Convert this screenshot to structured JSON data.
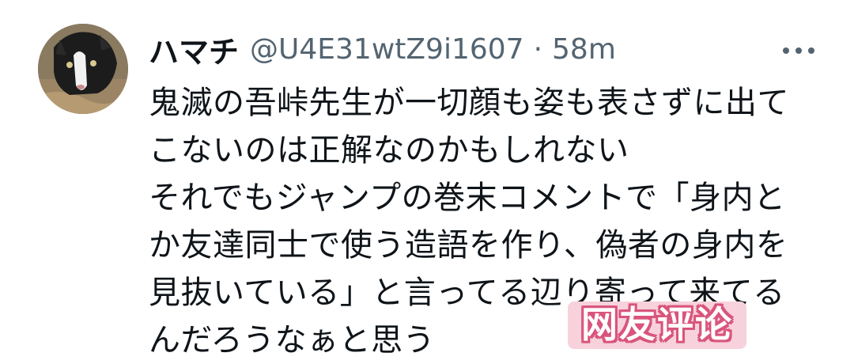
{
  "tweet": {
    "display_name": "ハマチ",
    "handle": "@U4E31wtZ9i1607",
    "separator": "·",
    "time": "58m",
    "more_icon": "more-horizontal-icon",
    "body_lines": [
      "鬼滅の吾峠先生が一切顔も姿も表さずに出て",
      "こないのは正解なのかもしれない",
      "それでもジャンプの巻末コメントで「身内と",
      "か友達同士で使う造語を作り、偽者の身内を",
      "見抜いている」と言ってる辺り寄って来てる",
      "んだろうなぁと思う"
    ]
  },
  "watermark": {
    "text": "网友评论",
    "colors": {
      "fill": "#f7d2dc",
      "outline": "#d9557d"
    }
  },
  "colors": {
    "text_primary": "#0f1419",
    "text_secondary": "#536471",
    "background": "#ffffff"
  }
}
